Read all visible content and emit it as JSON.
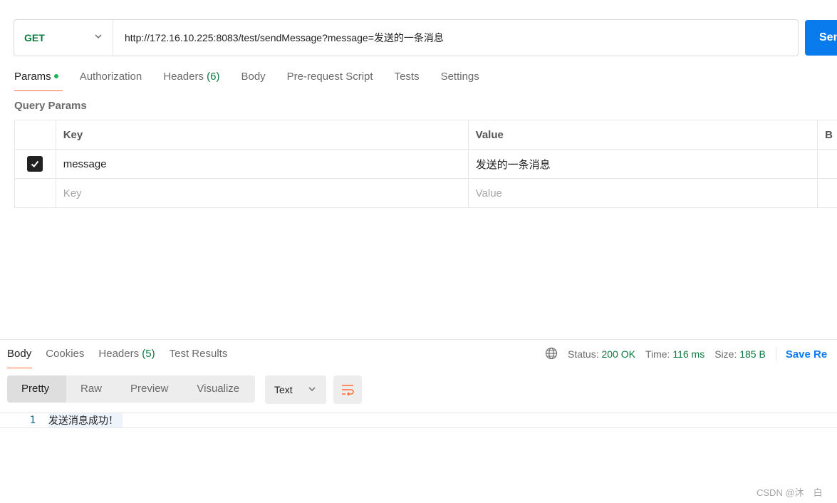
{
  "request": {
    "method": "GET",
    "url": "http://172.16.10.225:8083/test/sendMessage?message=发送的一条消息",
    "send_label": "Send"
  },
  "req_tabs": [
    {
      "label": "Params",
      "active": true
    },
    {
      "label": "Authorization"
    },
    {
      "label": "Headers",
      "count": "(6)"
    },
    {
      "label": "Body"
    },
    {
      "label": "Pre-request Script"
    },
    {
      "label": "Tests"
    },
    {
      "label": "Settings"
    }
  ],
  "query_params": {
    "title": "Query Params",
    "headers": {
      "key": "Key",
      "value": "Value",
      "extra": "B"
    },
    "rows": [
      {
        "checked": true,
        "key": "message",
        "value": "发送的一条消息"
      }
    ],
    "placeholder": {
      "key": "Key",
      "value": "Value"
    }
  },
  "response": {
    "tabs": [
      {
        "label": "Body",
        "active": true
      },
      {
        "label": "Cookies"
      },
      {
        "label": "Headers",
        "count": "(5)"
      },
      {
        "label": "Test Results"
      }
    ],
    "status_label": "Status:",
    "status_value": "200 OK",
    "time_label": "Time:",
    "time_value": "116 ms",
    "size_label": "Size:",
    "size_value": "185 B",
    "save_label": "Save Re",
    "view_modes": [
      "Pretty",
      "Raw",
      "Preview",
      "Visualize"
    ],
    "format": "Text",
    "lines": [
      {
        "n": "1",
        "text": "发送消息成功！"
      }
    ]
  },
  "watermark": "CSDN @沐　白",
  "colors": {
    "accent": "#ff6c37",
    "send": "#097bed",
    "ok": "#0b7a3e"
  }
}
